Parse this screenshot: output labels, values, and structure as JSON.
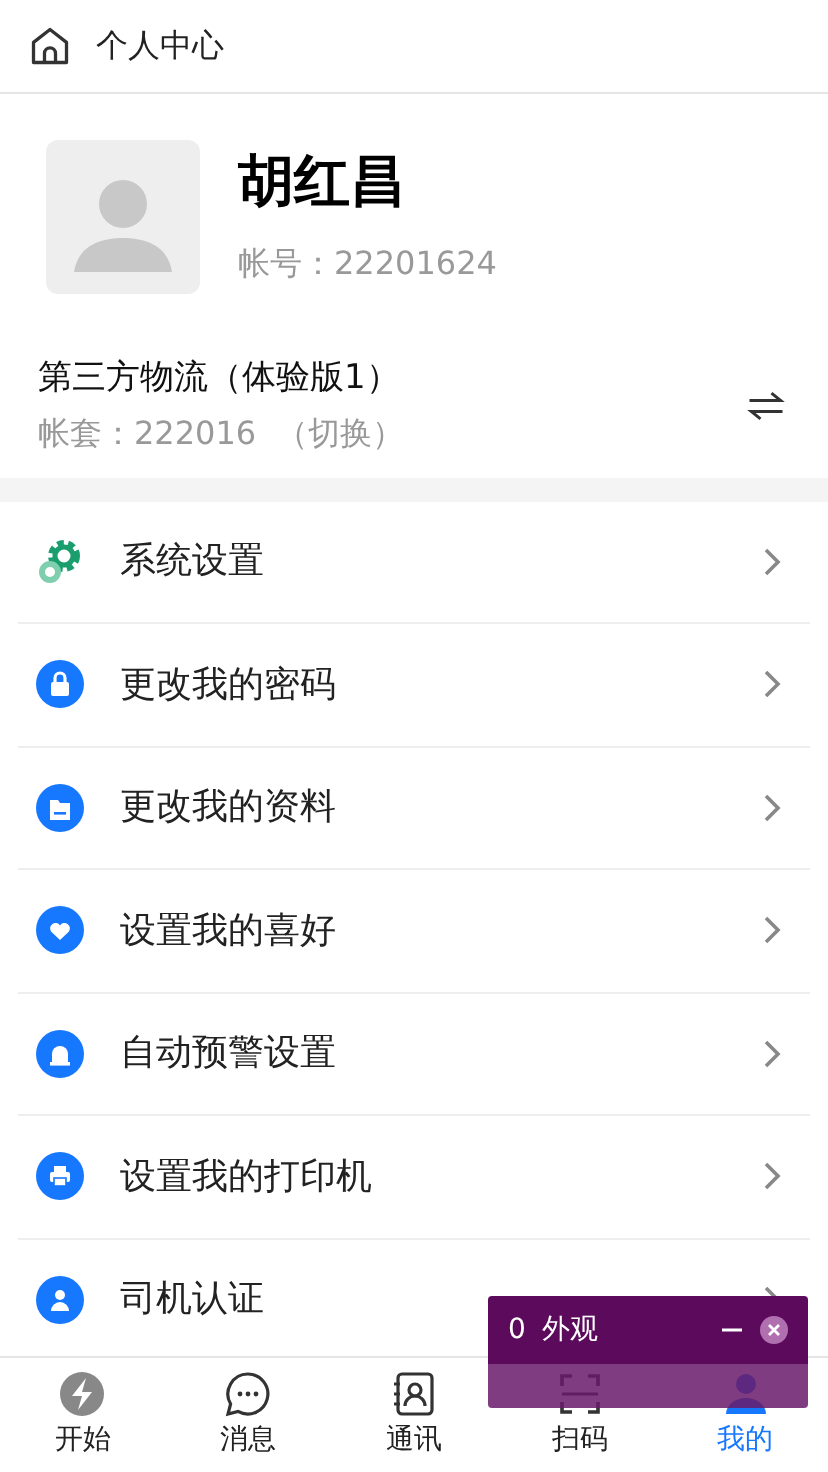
{
  "header": {
    "title": "个人中心"
  },
  "profile": {
    "name": "胡红昌",
    "account": "帐号：22201624"
  },
  "company": {
    "name": "第三方物流（体验版1）",
    "book": "帐套：222016",
    "switch": "（切换）"
  },
  "menu": [
    {
      "kind": "gear",
      "label": "系统设置"
    },
    {
      "kind": "lock",
      "label": "更改我的密码"
    },
    {
      "kind": "folder",
      "label": "更改我的资料"
    },
    {
      "kind": "heart",
      "label": "设置我的喜好"
    },
    {
      "kind": "alarm",
      "label": "自动预警设置"
    },
    {
      "kind": "printer",
      "label": "设置我的打印机"
    },
    {
      "kind": "driver",
      "label": "司机认证"
    }
  ],
  "tabs": [
    {
      "kind": "start",
      "label": "开始",
      "selected": false
    },
    {
      "kind": "message",
      "label": "消息",
      "selected": false
    },
    {
      "kind": "contacts",
      "label": "通讯",
      "selected": false
    },
    {
      "kind": "scan",
      "label": "扫码",
      "selected": false
    },
    {
      "kind": "me",
      "label": "我的",
      "selected": true
    }
  ],
  "overlay": {
    "count": "0",
    "label": "外观"
  }
}
